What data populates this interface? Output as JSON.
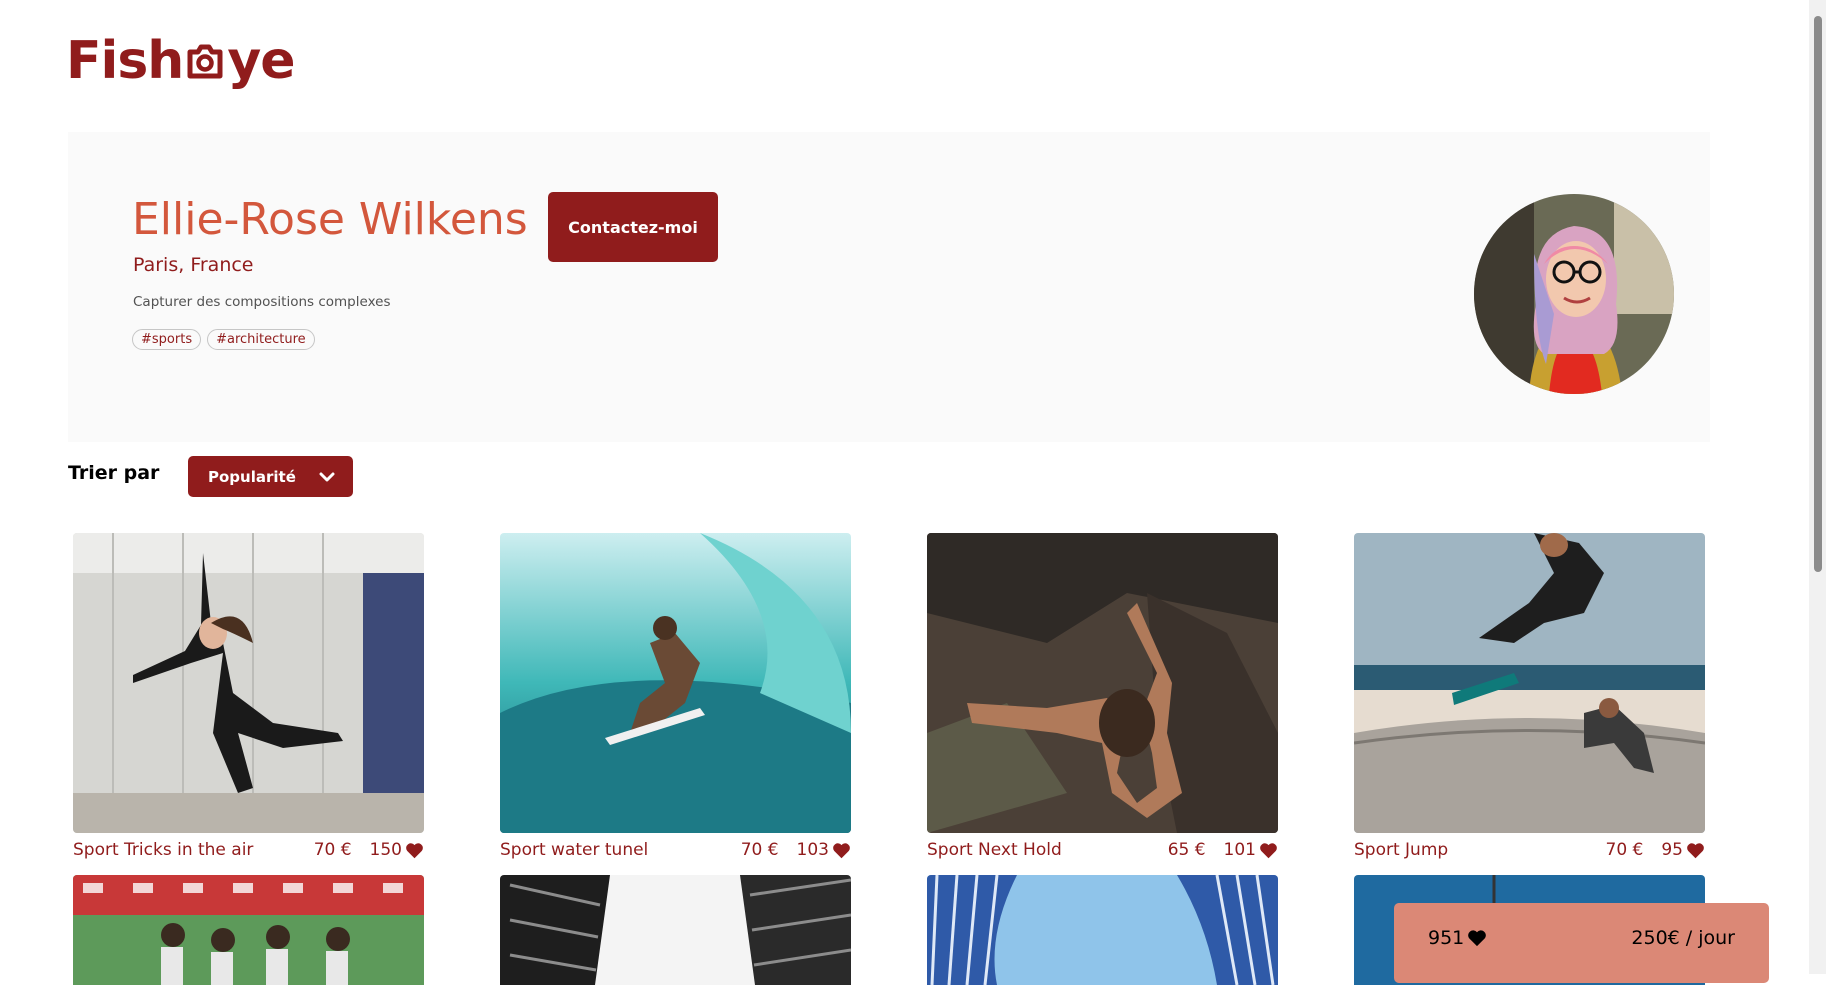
{
  "logo": {
    "text_left": "Fish",
    "text_right": "ye",
    "icon": "camera-icon"
  },
  "photographer": {
    "name": "Ellie-Rose Wilkens",
    "location": "Paris, France",
    "tagline": "Capturer des compositions complexes",
    "tags": [
      "#sports",
      "#architecture"
    ],
    "contact_label": "Contactez-moi",
    "avatar_icon": "avatar-portrait"
  },
  "sort": {
    "label": "Trier par",
    "selected": "Popularité",
    "icon": "chevron-down-icon"
  },
  "media": [
    {
      "title": "Sport Tricks in the air",
      "price": "70 €",
      "likes": "150"
    },
    {
      "title": "Sport water tunel",
      "price": "70 €",
      "likes": "103"
    },
    {
      "title": "Sport Next Hold",
      "price": "65 €",
      "likes": "101"
    },
    {
      "title": "Sport Jump",
      "price": "70 €",
      "likes": "95"
    }
  ],
  "stats": {
    "total_likes": "951",
    "rate": "250€ / jour",
    "icon": "heart-icon"
  },
  "colors": {
    "primary": "#901c1c",
    "accent": "#d3573c",
    "stats_bg": "#db8876",
    "header_bg": "#fafafa"
  }
}
